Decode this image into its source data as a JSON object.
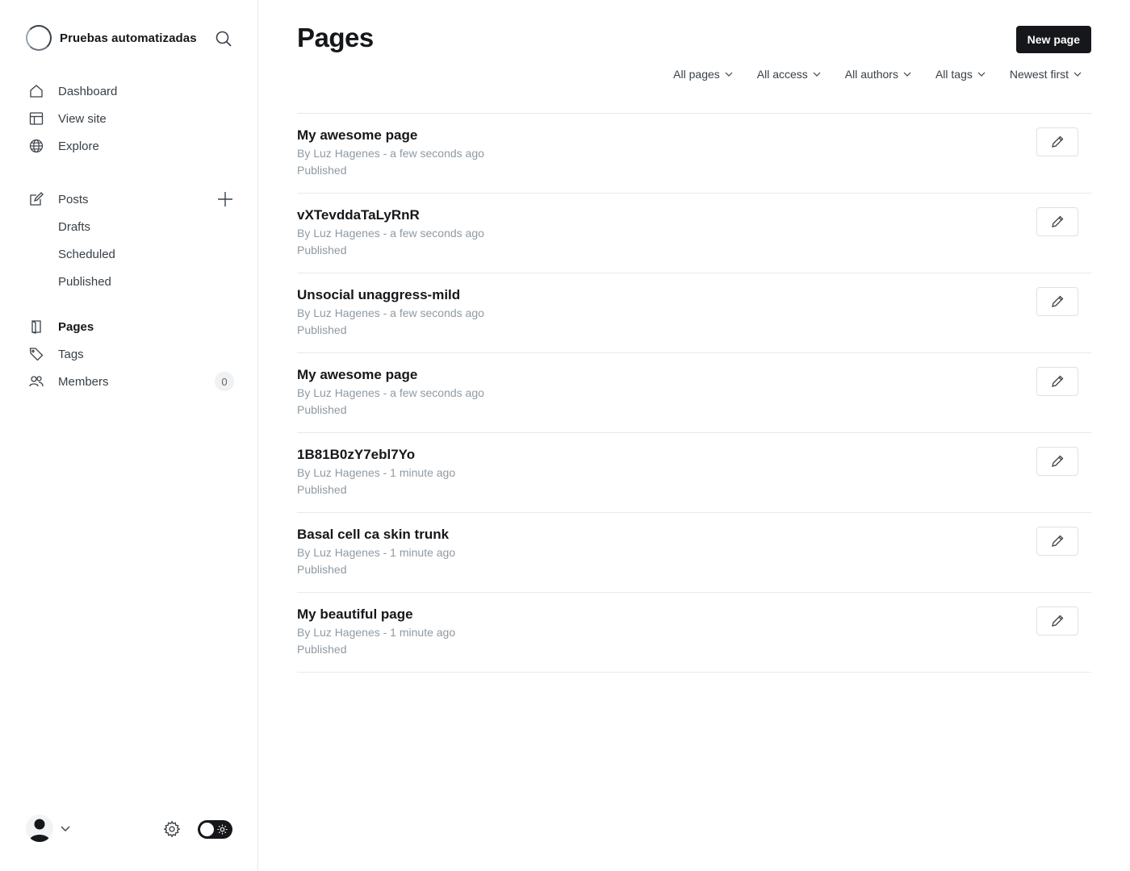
{
  "sidebar": {
    "site_name": "Pruebas automatizadas",
    "nav": [
      {
        "label": "Dashboard"
      },
      {
        "label": "View site"
      },
      {
        "label": "Explore"
      }
    ],
    "posts": {
      "label": "Posts"
    },
    "post_sub": [
      {
        "label": "Drafts"
      },
      {
        "label": "Scheduled"
      },
      {
        "label": "Published"
      }
    ],
    "pages": {
      "label": "Pages"
    },
    "tags": {
      "label": "Tags"
    },
    "members": {
      "label": "Members",
      "count": "0"
    }
  },
  "main": {
    "title": "Pages",
    "new_button": "New page",
    "filters": [
      "All pages",
      "All access",
      "All authors",
      "All tags",
      "Newest first"
    ],
    "rows": [
      {
        "title": "My awesome page",
        "meta": "By Luz Hagenes - a few seconds ago",
        "status": "Published"
      },
      {
        "title": "vXTevddaTaLyRnR",
        "meta": "By Luz Hagenes - a few seconds ago",
        "status": "Published"
      },
      {
        "title": "Unsocial unaggress-mild",
        "meta": "By Luz Hagenes - a few seconds ago",
        "status": "Published"
      },
      {
        "title": "My awesome page",
        "meta": "By Luz Hagenes - a few seconds ago",
        "status": "Published"
      },
      {
        "title": "1B81B0zY7ebl7Yo",
        "meta": "By Luz Hagenes - 1 minute ago",
        "status": "Published"
      },
      {
        "title": "Basal cell ca skin trunk",
        "meta": "By Luz Hagenes - 1 minute ago",
        "status": "Published"
      },
      {
        "title": "My beautiful page",
        "meta": "By Luz Hagenes - 1 minute ago",
        "status": "Published"
      }
    ]
  },
  "colors": {
    "accent_dark": "#15171a",
    "muted_text": "#8e9aa4",
    "border": "#e6e9eb"
  }
}
